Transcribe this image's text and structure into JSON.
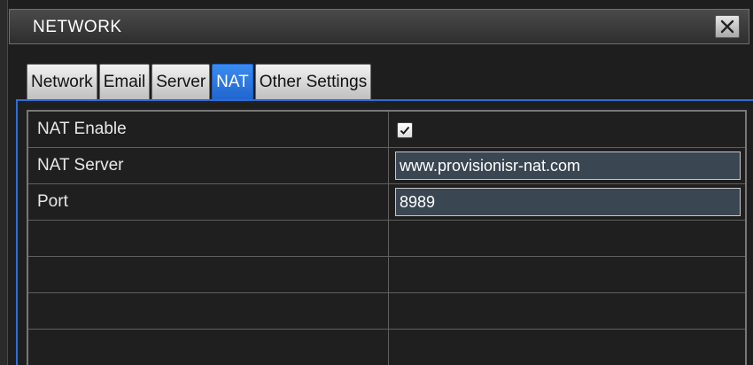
{
  "window": {
    "title": "NETWORK"
  },
  "tabs": [
    {
      "label": "Network",
      "active": false
    },
    {
      "label": "Email",
      "active": false
    },
    {
      "label": "Server",
      "active": false
    },
    {
      "label": "NAT",
      "active": true
    },
    {
      "label": "Other Settings",
      "active": false
    }
  ],
  "settings": {
    "rows": [
      {
        "label": "NAT Enable",
        "type": "checkbox",
        "checked": true
      },
      {
        "label": "NAT Server",
        "type": "text",
        "value": "www.provisionisr-nat.com"
      },
      {
        "label": "Port",
        "type": "text",
        "value": "8989"
      },
      {
        "label": "",
        "type": "empty"
      },
      {
        "label": "",
        "type": "empty"
      },
      {
        "label": "",
        "type": "empty"
      },
      {
        "label": "",
        "type": "empty"
      }
    ]
  },
  "colors": {
    "active_tab": "#2a78e0",
    "panel_border": "#2a6fd6",
    "input_bg": "#3a4652"
  },
  "icons": {
    "close": "close-x-icon",
    "check": "checkmark-icon"
  }
}
